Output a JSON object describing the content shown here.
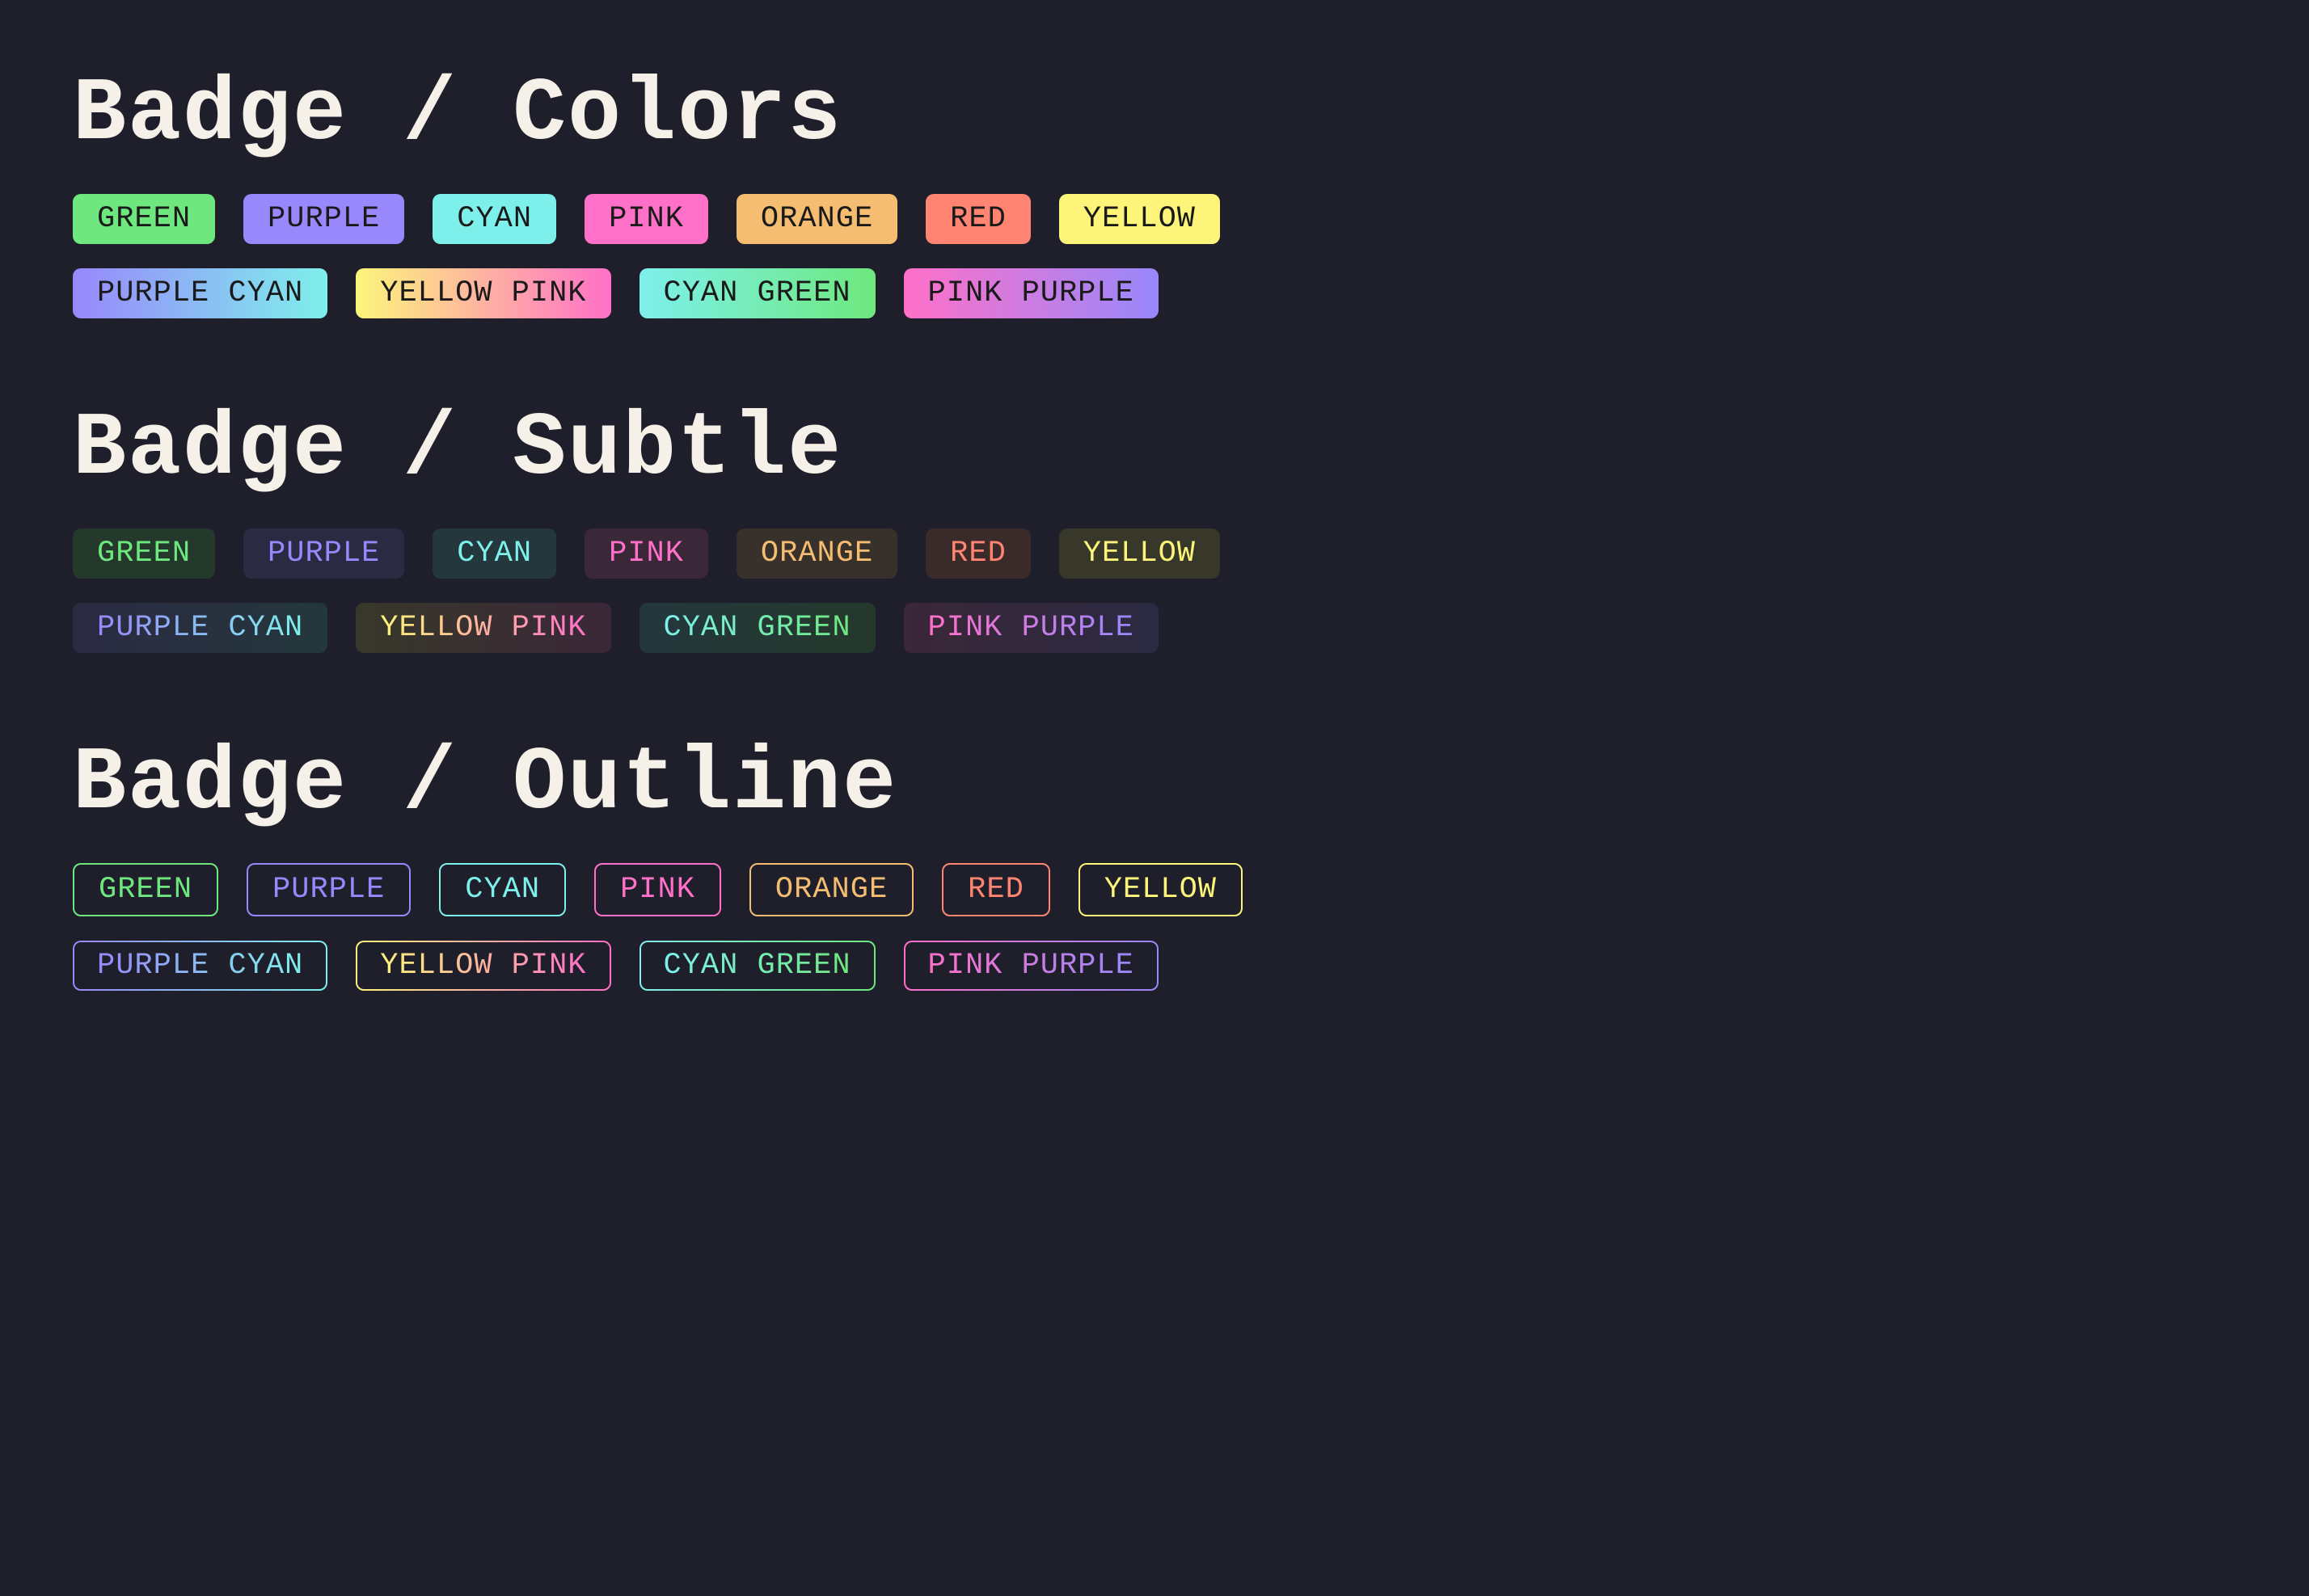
{
  "sections": {
    "colors": {
      "title": "Badge / Colors",
      "row1": {
        "green": "GREEN",
        "purple": "PURPLE",
        "cyan": "CYAN",
        "pink": "PINK",
        "orange": "ORANGE",
        "red": "RED",
        "yellow": "YELLOW"
      },
      "row2": {
        "purple_cyan": "PURPLE CYAN",
        "yellow_pink": "YELLOW PINK",
        "cyan_green": "CYAN GREEN",
        "pink_purple": "PINK PURPLE"
      }
    },
    "subtle": {
      "title": "Badge / Subtle",
      "row1": {
        "green": "GREEN",
        "purple": "PURPLE",
        "cyan": "CYAN",
        "pink": "PINK",
        "orange": "ORANGE",
        "red": "RED",
        "yellow": "YELLOW"
      },
      "row2": {
        "purple_cyan": "PURPLE CYAN",
        "yellow_pink": "YELLOW PINK",
        "cyan_green": "CYAN GREEN",
        "pink_purple": "PINK PURPLE"
      }
    },
    "outline": {
      "title": "Badge / Outline",
      "row1": {
        "green": "GREEN",
        "purple": "PURPLE",
        "cyan": "CYAN",
        "pink": "PINK",
        "orange": "ORANGE",
        "red": "RED",
        "yellow": "YELLOW"
      },
      "row2": {
        "purple_cyan": "PURPLE CYAN",
        "yellow_pink": "YELLOW PINK",
        "cyan_green": "CYAN GREEN",
        "pink_purple": "PINK PURPLE"
      }
    }
  },
  "colors": {
    "green": "#6ee87e",
    "purple": "#9888fb",
    "cyan": "#7ef0ec",
    "pink": "#ff70c8",
    "orange": "#f5bd72",
    "red": "#ff8472",
    "yellow": "#fcf57a",
    "background": "#1e1f2b",
    "title": "#f5f0e8"
  }
}
